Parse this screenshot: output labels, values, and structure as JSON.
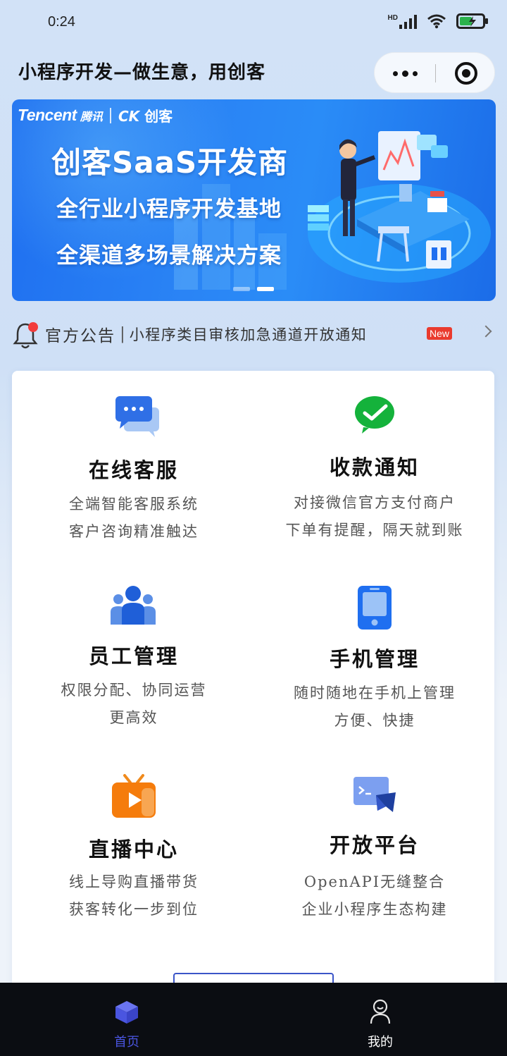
{
  "status_bar": {
    "time": "0:24",
    "network": "HD"
  },
  "header": {
    "title": "小程序开发—做生意，用创客"
  },
  "banner": {
    "brand_en": "Tencent",
    "brand_cn": "腾讯",
    "brand_ck": "创客",
    "headline": "创客SaaS开发商",
    "line2": "全行业小程序开发基地",
    "line3": "全渠道多场景解决方案",
    "slides_total": 2,
    "active_slide": 2
  },
  "notice": {
    "title": "官方公告",
    "separator": "|",
    "text": "小程序类目审核加急通道开放通知",
    "badge": "New"
  },
  "features": [
    {
      "icon": "chat-bubbles-icon",
      "title": "在线客服",
      "desc1": "全端智能客服系统",
      "desc2": "客户咨询精准触达"
    },
    {
      "icon": "wechat-pay-icon",
      "title": "收款通知",
      "desc1": "对接微信官方支付商户",
      "desc2": "下单有提醒，隔天就到账"
    },
    {
      "icon": "team-icon",
      "title": "员工管理",
      "desc1": "权限分配、协同运营",
      "desc2": "更高效"
    },
    {
      "icon": "phone-icon",
      "title": "手机管理",
      "desc1": "随时随地在手机上管理",
      "desc2": "方便、快捷"
    },
    {
      "icon": "tv-play-icon",
      "title": "直播中心",
      "desc1": "线上导购直播带货",
      "desc2": "获客转化一步到位"
    },
    {
      "icon": "terminal-icon",
      "title": "开放平台",
      "desc1": "OpenAPI无缝整合",
      "desc2": "企业小程序生态构建"
    }
  ],
  "tabbar": [
    {
      "label": "首页",
      "active": true,
      "color": "#4a55e0"
    },
    {
      "label": "我的",
      "active": false,
      "color": "#ffffff"
    }
  ],
  "colors": {
    "accent": "#2a84f5",
    "card": "#ffffff",
    "tabbar": "#0b0d12"
  }
}
